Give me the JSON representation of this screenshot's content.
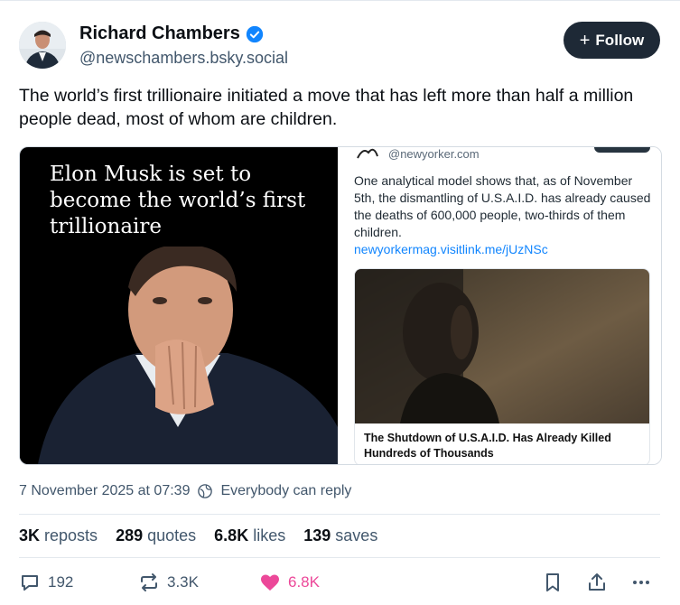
{
  "author": {
    "name": "Richard Chambers",
    "handle": "@newschambers.bsky.social"
  },
  "follow_label": "Follow",
  "post_text": "The world’s first trillionaire initiated a move that has left more than half a million people dead, most of whom are children.",
  "image_left": {
    "headline": "Elon Musk is set to become the world’s first trillionaire"
  },
  "image_right": {
    "handle": "@newyorker.com",
    "text": "One analytical model shows that, as of November 5th, the dismantling of U.S.A.I.D. has already caused the deaths of 600,000 people, two-thirds of them children.",
    "link": "newyorkermag.visitlink.me/jUzNSc",
    "card_title": "The Shutdown of U.S.A.I.D. Has Already Killed Hundreds of Thousands"
  },
  "meta": {
    "timestamp": "7 November 2025 at 07:39",
    "reply_setting": "Everybody can reply"
  },
  "stats": {
    "reposts_count": "3K",
    "reposts_label": "reposts",
    "quotes_count": "289",
    "quotes_label": "quotes",
    "likes_count": "6.8K",
    "likes_label": "likes",
    "saves_count": "139",
    "saves_label": "saves"
  },
  "actions": {
    "replies": "192",
    "reposts": "3.3K",
    "likes": "6.8K"
  },
  "colors": {
    "accent": "#1185fe",
    "like": "#ec4899",
    "follow_bg": "#1e2936"
  },
  "icons": [
    "verified-badge-icon",
    "plus-icon",
    "reply-setting-icon",
    "reply-icon",
    "repost-icon",
    "heart-icon",
    "bookmark-icon",
    "share-icon",
    "more-icon"
  ]
}
